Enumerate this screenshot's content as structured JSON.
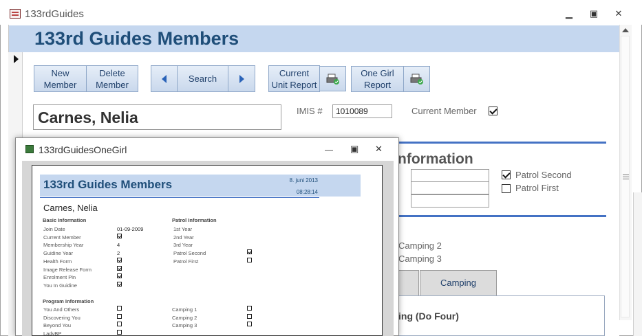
{
  "main_window": {
    "title": "133rdGuides",
    "controls": {
      "minimize": "▭",
      "restore": "▢",
      "close": "✕"
    }
  },
  "form": {
    "header_title": "133rd Guides Members",
    "buttons": {
      "new_member": "New\nMember",
      "delete_member": "Delete\nMember",
      "search": "Search",
      "current_unit_report": "Current\nUnit Report",
      "one_girl_report": "One Girl\nReport"
    },
    "member_name": "Carnes, Nelia",
    "imis_label": "IMIS #",
    "imis_value": "1010089",
    "current_member_label": "Current Member",
    "current_member_checked": true,
    "section_heading_partial": "nformation",
    "patrol_second_label": "Patrol Second",
    "patrol_second_checked": true,
    "patrol_first_label": "Patrol First",
    "patrol_first_checked": false,
    "camping2_label": "Camping 2",
    "camping3_label": "Camping 3",
    "tab_camping": "Camping",
    "panel_heading_partial": "ing (Do Four)"
  },
  "popup": {
    "title": "133rdGuidesOneGirl",
    "controls": {
      "minimize": "—",
      "restore": "▢",
      "close": "✕"
    },
    "report": {
      "title": "133rd Guides Members",
      "date": "8. juni 2013",
      "time": "08:28:14",
      "name": "Carnes, Nelia",
      "basic_heading": "Basic Information",
      "basic": [
        {
          "label": "Join Date",
          "value": "01-09-2009"
        },
        {
          "label": "Current Member",
          "check": true
        },
        {
          "label": "Membership Year",
          "value": "4"
        },
        {
          "label": "Guidine Year",
          "value": "2"
        },
        {
          "label": "Health Form",
          "check": true
        },
        {
          "label": "Image Release Form",
          "check": true
        },
        {
          "label": "Enrolment Pin",
          "check": true
        },
        {
          "label": "You In Guidine",
          "check": true
        }
      ],
      "patrol_heading": "Patrol Information",
      "patrol": [
        {
          "label": "1st Year"
        },
        {
          "label": "2nd Year"
        },
        {
          "label": "3rd Year"
        },
        {
          "label": "Patrol Second",
          "check": true
        },
        {
          "label": "Patrol First",
          "check": false
        }
      ],
      "program_heading": "Program Information",
      "program": [
        {
          "label": "You And Others",
          "check": false
        },
        {
          "label": "Discovering You",
          "check": false
        },
        {
          "label": "Beyond You",
          "check": false
        },
        {
          "label": "LadyBP",
          "check": false
        }
      ],
      "camping": [
        {
          "label": "Camping 1",
          "check": false
        },
        {
          "label": "Camping 2",
          "check": false
        },
        {
          "label": "Camping 3",
          "check": false
        }
      ]
    }
  },
  "colors": {
    "header_band": "#c5d7ef",
    "header_text": "#1f4e79",
    "accent_rule": "#4472c4"
  }
}
